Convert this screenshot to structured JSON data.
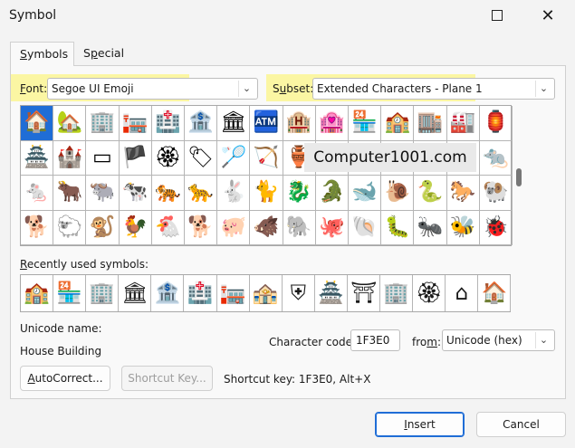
{
  "window": {
    "title": "Symbol"
  },
  "tabs": [
    {
      "label": "Symbols",
      "underline": "S",
      "rest": "ymbols"
    },
    {
      "label": "Special Characters",
      "pre": "S",
      "underline": "p",
      "rest": "ecial Characters"
    }
  ],
  "font": {
    "label_u": "F",
    "label_rest": "ont:",
    "value": "Segoe UI Emoji"
  },
  "subset": {
    "label_pre": "S",
    "label_u": "u",
    "label_rest": "bset:",
    "value": "Extended Characters - Plane 1"
  },
  "symbols_grid": {
    "rows": [
      [
        "🏠",
        "🏡",
        "🏢",
        "🏣",
        "🏥",
        "🏦",
        "🏛",
        "🏧",
        "🏨",
        "🏩",
        "🏪",
        "🏫",
        "🏬",
        "🏭",
        "🏮"
      ],
      [
        "🏯",
        "🏰",
        "▭",
        "🏴",
        "🏵",
        "🏷",
        "🏸",
        "🏹",
        "🏺",
        "🐀",
        "🐁",
        "🐂",
        "🐃",
        "🐄",
        "🐀"
      ],
      [
        "🐁",
        "🐂",
        "🐃",
        "🐄",
        "🐅",
        "🐆",
        "🐇",
        "🐈",
        "🐉",
        "🐊",
        "🐋",
        "🐌",
        "🐍",
        "🐎",
        "🐏"
      ],
      [
        "🐕",
        "🐑",
        "🐒",
        "🐓",
        "🐔",
        "🐕",
        "🐖",
        "🐗",
        "🐘",
        "🐙",
        "🐚",
        "🐛",
        "🐜",
        "🐝",
        "🐞"
      ]
    ]
  },
  "watermark": "Computer1001.com",
  "recent": {
    "label_u": "R",
    "label_rest": "ecently used symbols:",
    "symbols": [
      "🏫",
      "🏪",
      "🏢",
      "🏛",
      "🏦",
      "🏥",
      "🏣",
      "🏤",
      "⛨",
      "🏯",
      "⛩",
      "🏢",
      "🏵",
      "⌂",
      "🏠"
    ]
  },
  "unicode_name": {
    "label": "Unicode name:",
    "value": "House Building"
  },
  "character_code": {
    "label_pre": "Character code:",
    "value": "1F3E0"
  },
  "from": {
    "label_pre": "fro",
    "label_u": "m",
    "label_rest": ":",
    "value": "Unicode (hex)"
  },
  "buttons": {
    "autocorrect": {
      "u": "A",
      "rest": "utoCorrect..."
    },
    "shortcut_key": "Shortcut Key...",
    "insert": {
      "u": "I",
      "rest": "nsert"
    },
    "cancel": "Cancel"
  },
  "shortcut_info": "Shortcut key: 1F3E0, Alt+X",
  "colors": {
    "accent": "#1f6dd6",
    "highlight": "#fbf6a3"
  }
}
